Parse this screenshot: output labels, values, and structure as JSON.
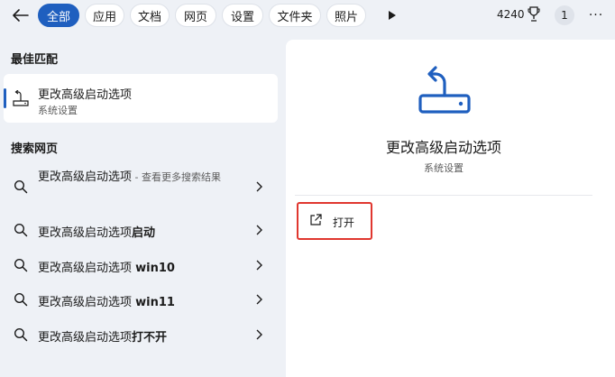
{
  "topbar": {
    "tabs": [
      {
        "label": "全部",
        "active": true
      },
      {
        "label": "应用",
        "active": false
      },
      {
        "label": "文档",
        "active": false
      },
      {
        "label": "网页",
        "active": false
      },
      {
        "label": "设置",
        "active": false
      },
      {
        "label": "文件夹",
        "active": false
      },
      {
        "label": "照片",
        "active": false
      }
    ],
    "points": "4240",
    "avatar_initial": "1",
    "accent_color": "#1f5fbf"
  },
  "best_match": {
    "heading": "最佳匹配",
    "title": "更改高级启动选项",
    "subtitle": "系统设置",
    "icon": "settings-restore-icon"
  },
  "web_search": {
    "heading": "搜索网页",
    "items": [
      {
        "normal": "更改高级启动选项",
        "bold": "",
        "hint": " - 查看更多搜索结果"
      },
      {
        "normal": "更改高级启动选项",
        "bold": "启动",
        "hint": ""
      },
      {
        "normal": "更改高级启动选项 ",
        "bold": "win10",
        "hint": ""
      },
      {
        "normal": "更改高级启动选项 ",
        "bold": "win11",
        "hint": ""
      },
      {
        "normal": "更改高级启动选项",
        "bold": "打不开",
        "hint": ""
      }
    ]
  },
  "detail": {
    "title": "更改高级启动选项",
    "subtitle": "系统设置",
    "open_label": "打开",
    "highlight_color": "#e0372f"
  }
}
